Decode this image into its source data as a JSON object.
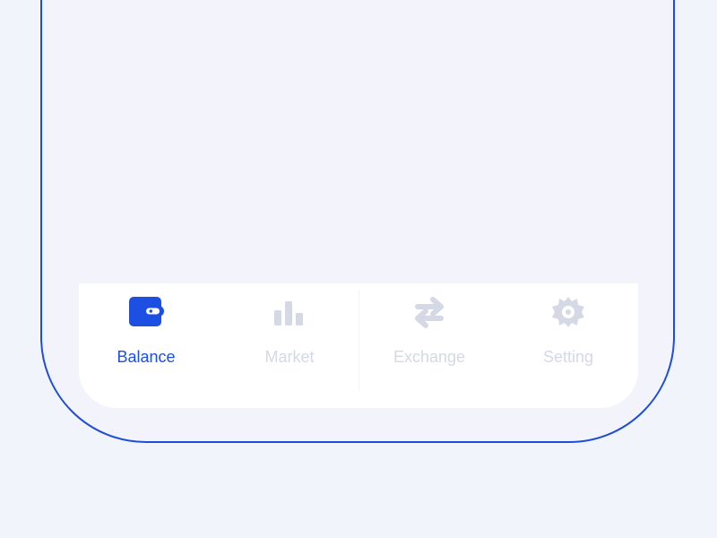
{
  "tabs": [
    {
      "id": "balance",
      "label": "Balance",
      "icon": "wallet-icon",
      "active": true
    },
    {
      "id": "market",
      "label": "Market",
      "icon": "bar-chart-icon",
      "active": false
    },
    {
      "id": "exchange",
      "label": "Exchange",
      "icon": "exchange-arrows-icon",
      "active": false
    },
    {
      "id": "setting",
      "label": "Setting",
      "icon": "gear-icon",
      "active": false
    }
  ],
  "colors": {
    "background": "#f2f4fb",
    "frame": "#1d4ed8",
    "active": "#1d4fe3",
    "inactive": "#d5d9e6",
    "tab_bar": "#ffffff"
  }
}
